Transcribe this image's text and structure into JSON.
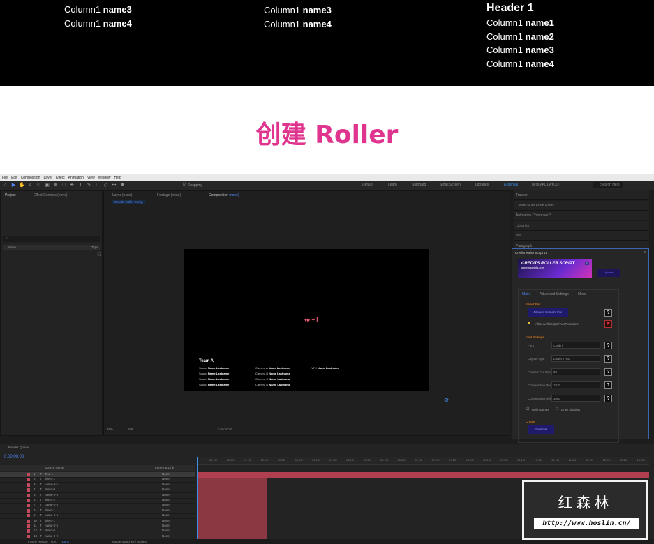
{
  "credits": {
    "col_a": [
      {
        "label": "Column1",
        "name": "name3"
      },
      {
        "label": "Column1",
        "name": "name4"
      }
    ],
    "col_b": [
      {
        "label": "Column1",
        "name": "name3"
      },
      {
        "label": "Column1",
        "name": "name4"
      }
    ],
    "col_c_header": "Header 1",
    "col_c": [
      {
        "label": "Column1",
        "name": "name1"
      },
      {
        "label": "Column1",
        "name": "name2"
      },
      {
        "label": "Column1",
        "name": "name3"
      },
      {
        "label": "Column1",
        "name": "name4"
      }
    ]
  },
  "heading": {
    "text": "创建 Roller",
    "color": "#e0358f"
  },
  "ae": {
    "menu": [
      "File",
      "Edit",
      "Composition",
      "Layer",
      "Effect",
      "Animation",
      "View",
      "Window",
      "Help"
    ],
    "snapping": "Snapping",
    "workspaces": [
      "Default",
      "Learn",
      "Standard",
      "Small Screen",
      "Libraries",
      "Essential",
      "MINIMAL LAYOUT"
    ],
    "active_workspace": "Essential",
    "search_help": "Search Help",
    "project_tab": "Project",
    "effect_controls_tab": "Effect Controls (none)",
    "layer_tab": "Layer (none)",
    "footage_tab": "Footage (none)",
    "composition_tab": "Composition",
    "composition_name": "(none)",
    "comp_flow_label": "Credits Roller Comp",
    "project_search_placeholder": "⌕",
    "project_col_name": "Name",
    "project_col_type": "Type",
    "viewer": {
      "team": "Team A",
      "roles_col1": [
        "Sound",
        "Sound",
        "Sound",
        "Sound"
      ],
      "names_col1": [
        "Name Lastname",
        "Name Lastname",
        "Name Lastname",
        "Name Lastname"
      ],
      "roles_col2": [
        "Camera A",
        "Camera B",
        "Camera C",
        "Camera D"
      ],
      "names_col2": [
        "Name Lastname",
        "Name Lastname",
        "Name Lastname",
        "Name Lastname"
      ],
      "roles_col3": [
        "VFX"
      ],
      "names_col3": [
        "Name Lastname"
      ],
      "center_glyph": "♦▸ + I"
    },
    "viewer_zoom": "97%",
    "viewer_res": "Full",
    "viewer_time": "0:00:00:00",
    "right_panels": [
      "Tracker",
      "Create Nulls From Paths",
      "Animation Composer 3",
      "Libraries",
      "Info",
      "Paragraph"
    ],
    "script": {
      "title": "Credits Roller Script v1",
      "logo_text": "CREDITS ROLLER SCRIPT",
      "logo_badge": "v1",
      "logo_url": "www.aiscripts.com",
      "version_btn": "Update",
      "tabs": [
        "Main",
        "Advanced Settings",
        "More"
      ],
      "active_tab": "Main",
      "select_file_label": "Select File",
      "browse_btn": "Browse Content File",
      "file_path": "/AllNewAllScripts/TwoTeamLine",
      "font_settings_label": "Font Settings",
      "fields": [
        {
          "label": "Font",
          "value": "Calibri"
        },
        {
          "label": "Layout Type",
          "value": "Lower Third"
        },
        {
          "label": "Frames Per Second",
          "value": "30"
        },
        {
          "label": "Composition Width",
          "value": "1920"
        },
        {
          "label": "Composition Height",
          "value": "1080"
        }
      ],
      "bold_names": "Bold Names",
      "drop_shadow": "Drop Shadow",
      "create_label": "Create",
      "create_btn": "Generate",
      "help_glyph": "?",
      "remove_glyph": "✖"
    },
    "timeline": {
      "render_queue_tab": "Render Queue",
      "timecode": "0;00;00;00",
      "col_source": "Source Name",
      "col_parent": "Parent & Link",
      "layers": [
        {
          "num": "1",
          "name": "Text 1"
        },
        {
          "num": "2",
          "name": "title-0-1"
        },
        {
          "num": "3",
          "name": "name-0-1"
        },
        {
          "num": "4",
          "name": "title-0-0"
        },
        {
          "num": "5",
          "name": "name-0-0"
        },
        {
          "num": "6",
          "name": "title-0-2"
        },
        {
          "num": "7",
          "name": "name-0-2"
        },
        {
          "num": "8",
          "name": "title-0-1"
        },
        {
          "num": "9",
          "name": "name-0-1"
        },
        {
          "num": "10",
          "name": "title-0-1"
        },
        {
          "num": "11",
          "name": "name-0-1"
        },
        {
          "num": "12",
          "name": "title-0-0"
        },
        {
          "num": "13",
          "name": "name-0-0"
        }
      ],
      "parent_value": "None",
      "ticks": [
        "00:15f",
        "01:00f",
        "01:15f",
        "02:00f",
        "02:15f",
        "03:00f",
        "03:15f",
        "04:00f",
        "04:15f",
        "05:00f",
        "05:15f",
        "06:00f",
        "06:15f",
        "07:00f",
        "07:15f",
        "08:00f",
        "08:15f",
        "09:00f",
        "09:15f",
        "10:00f",
        "10:15f",
        "11:00f",
        "11:15f",
        "12:00f",
        "12:15f",
        "13:00f",
        "13:15f"
      ],
      "footer_left": "Frame Render Time:",
      "footer_time": "18ms",
      "footer_mid": "Toggle Switches / Modes"
    }
  },
  "watermark": {
    "cn": "红森林",
    "url": "http://www.hoslin.cn/"
  }
}
